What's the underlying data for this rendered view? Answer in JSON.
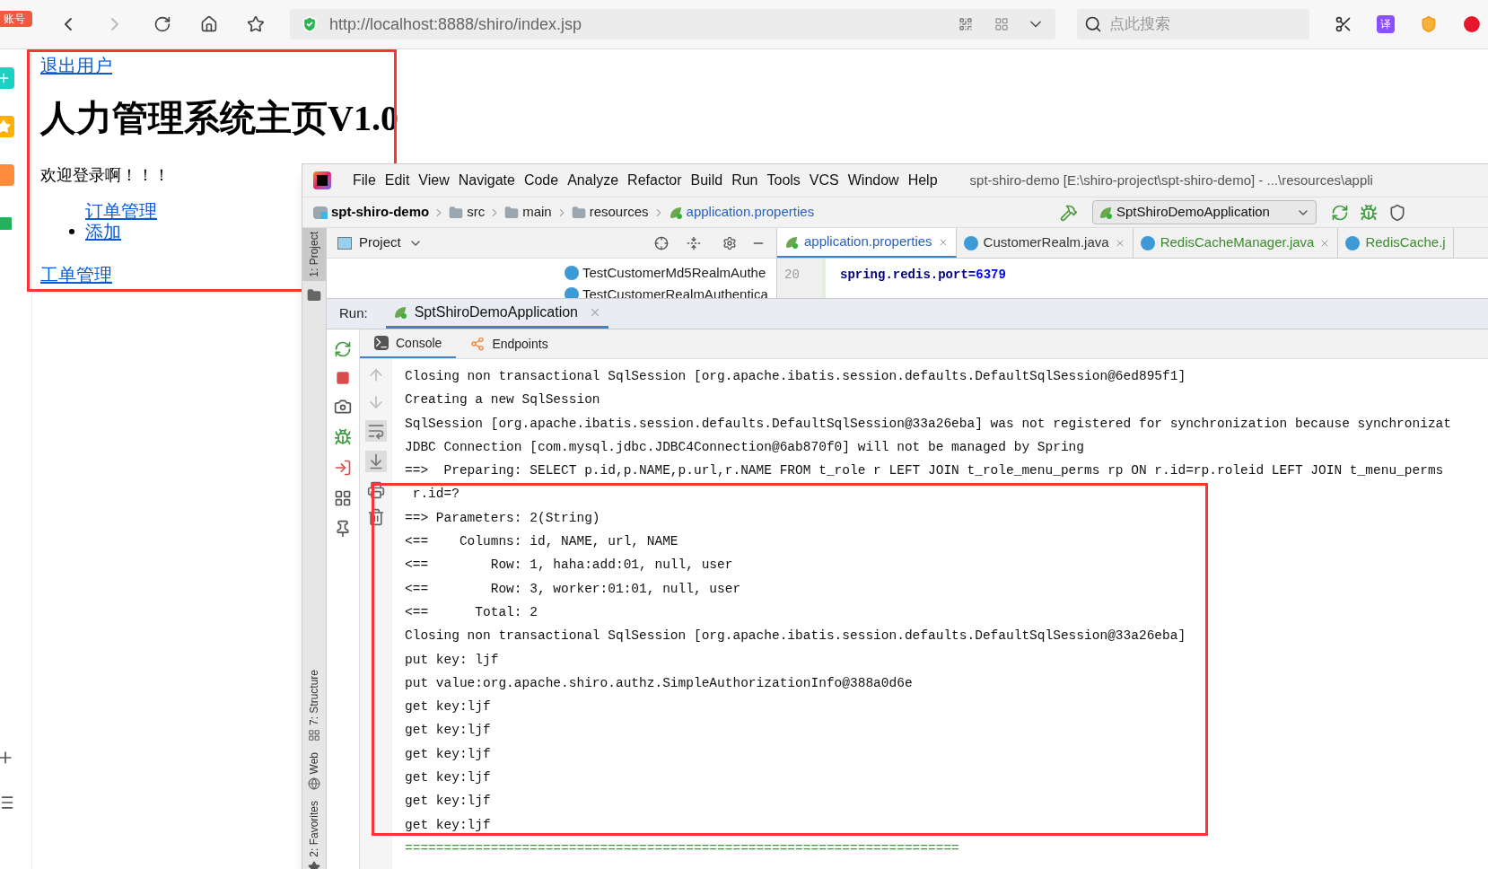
{
  "browser": {
    "badge": "账号",
    "url_host": "http://localhost",
    "url_rest": ":8888/shiro/index.jsp",
    "search_placeholder": "点此搜索",
    "translate_label": "译"
  },
  "page": {
    "logout_link": "退出用户",
    "heading": "人力管理系统主页V1.0",
    "welcome": "欢迎登录啊！！！",
    "menu": [
      {
        "label": "订单管理",
        "bullet": false
      },
      {
        "label": "添加",
        "bullet": true
      }
    ],
    "work_order_link": "工单管理"
  },
  "ide": {
    "menus": [
      "File",
      "Edit",
      "View",
      "Navigate",
      "Code",
      "Analyze",
      "Refactor",
      "Build",
      "Run",
      "Tools",
      "VCS",
      "Window",
      "Help"
    ],
    "title": "spt-shiro-demo [E:\\shiro-project\\spt-shiro-demo] - ...\\resources\\appli",
    "breadcrumb": [
      {
        "label": "spt-shiro-demo",
        "kind": "module"
      },
      {
        "label": "src",
        "kind": "folder"
      },
      {
        "label": "main",
        "kind": "folder"
      },
      {
        "label": "resources",
        "kind": "resources"
      },
      {
        "label": "application.properties",
        "kind": "file"
      }
    ],
    "run_config": "SptShiroDemoApplication",
    "project_panel": {
      "title": "Project",
      "items": [
        "TestCustomerMd5RealmAuthe",
        "TestCustomerRealmAuthentica"
      ]
    },
    "editor_tabs": [
      {
        "label": "application.properties",
        "selected": true,
        "kind": "properties",
        "color": "#2a5fc0"
      },
      {
        "label": "CustomerRealm.java",
        "selected": false,
        "kind": "class",
        "color": "#333333"
      },
      {
        "label": "RedisCacheManager.java",
        "selected": false,
        "kind": "class",
        "color": "#3c8a2e"
      },
      {
        "label": "RedisCache.j",
        "selected": false,
        "kind": "class",
        "color": "#3c8a2e"
      }
    ],
    "editor_lines": [
      {
        "number": "20",
        "key": "spring.redis.port=",
        "value": "6379"
      }
    ],
    "side_tabs": [
      "1: Project",
      "7: Structure",
      "Web",
      "2: Favorites"
    ],
    "run": {
      "label": "Run:",
      "tab": "SptShiroDemoApplication",
      "console_tabs": [
        {
          "label": "Console",
          "selected": true
        },
        {
          "label": "Endpoints",
          "selected": false
        }
      ],
      "lines": [
        "Closing non transactional SqlSession [org.apache.ibatis.session.defaults.DefaultSqlSession@6ed895f1]",
        "Creating a new SqlSession",
        "SqlSession [org.apache.ibatis.session.defaults.DefaultSqlSession@33a26eba] was not registered for synchronization because synchronizat",
        "JDBC Connection [com.mysql.jdbc.JDBC4Connection@6ab870f0] will not be managed by Spring",
        "==>  Preparing: SELECT p.id,p.NAME,p.url,r.NAME FROM t_role r LEFT JOIN t_role_menu_perms rp ON r.id=rp.roleid LEFT JOIN t_menu_perms",
        " r.id=?",
        "==> Parameters: 2(String)",
        "<==    Columns: id, NAME, url, NAME",
        "<==        Row: 1, haha:add:01, null, user",
        "<==        Row: 3, worker:01:01, null, user",
        "<==      Total: 2",
        "Closing non transactional SqlSession [org.apache.ibatis.session.defaults.DefaultSqlSession@33a26eba]",
        "put key: ljf",
        "put value:org.apache.shiro.authz.SimpleAuthorizationInfo@388a0d6e",
        "get key:ljf",
        "get key:ljf",
        "get key:ljf",
        "get key:ljf",
        "get key:ljf",
        "get key:ljf"
      ],
      "separator": "======================================================================="
    }
  }
}
